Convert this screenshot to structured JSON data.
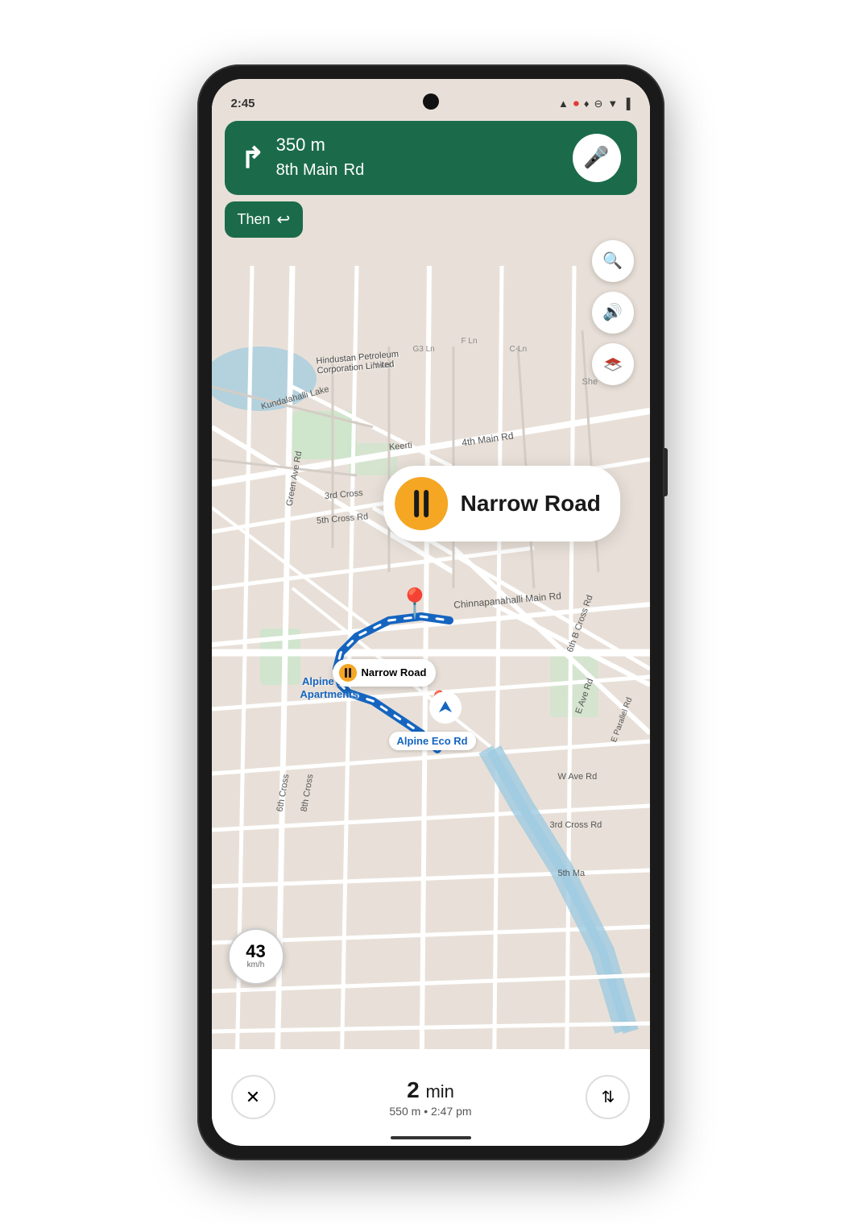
{
  "status_bar": {
    "time": "2:45",
    "icons": [
      "▲",
      "◎",
      "♦"
    ]
  },
  "navigation": {
    "distance": "350 m",
    "street_name": "8th Main",
    "street_suffix": "Rd",
    "then_label": "Then",
    "turn_arrow": "↱",
    "then_arrow": "↩"
  },
  "mic_button_label": "🎤",
  "buttons": {
    "search_icon": "🔍",
    "audio_icon": "🔊",
    "layers_icon": "▲"
  },
  "narrow_road": {
    "label": "Narrow Road",
    "tooltip_label": "Narrow Road"
  },
  "speed": {
    "value": "43",
    "unit": "km/h"
  },
  "eta": {
    "minutes": "2",
    "min_label": "min",
    "distance": "550 m",
    "arrival_time": "2:47 pm"
  },
  "map_labels": {
    "alpine_eco_rd": "Alpine Eco Rd",
    "apartments": "Alpine Eco\nApartments",
    "road_label_color": "#1565C0"
  },
  "bottom_buttons": {
    "close_label": "✕",
    "routes_label": "⇅"
  }
}
